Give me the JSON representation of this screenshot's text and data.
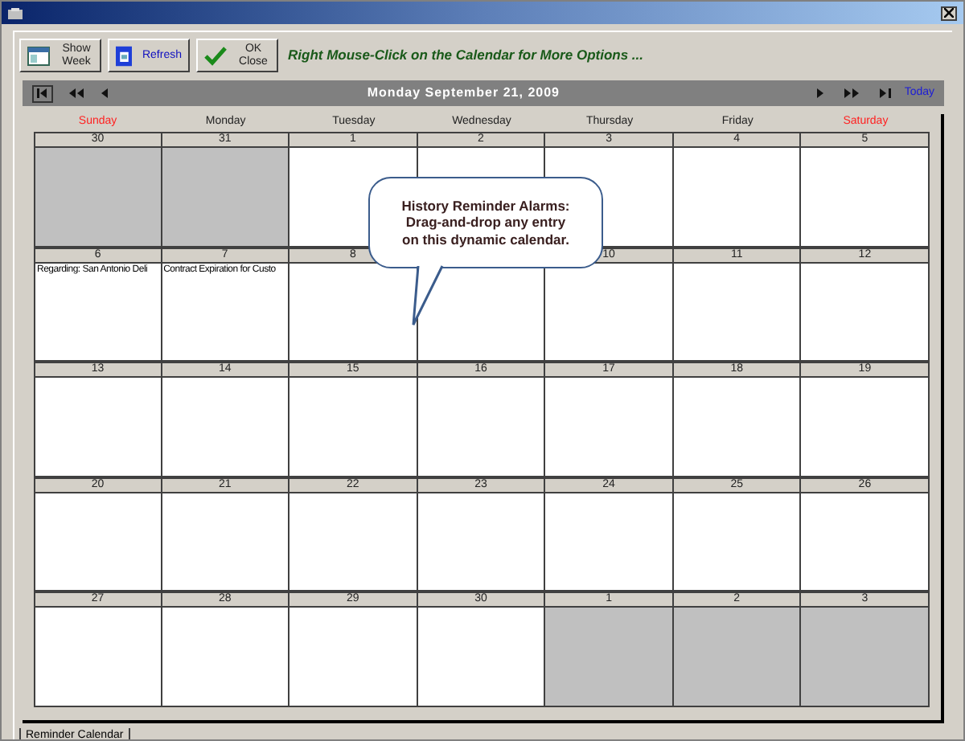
{
  "toolbar": {
    "buttons": [
      {
        "kind": "week",
        "label": "Show\nWeek"
      },
      {
        "kind": "refresh",
        "label": "Refresh"
      },
      {
        "kind": "close",
        "label": "OK\nClose"
      }
    ],
    "hint": "Right Mouse-Click on the Calendar for More Options ..."
  },
  "nav": {
    "date": "Monday September 21, 2009",
    "today": "Today"
  },
  "weekdays": [
    {
      "label": "Sunday",
      "weekend": true
    },
    {
      "label": "Monday",
      "weekend": false
    },
    {
      "label": "Tuesday",
      "weekend": false
    },
    {
      "label": "Wednesday",
      "weekend": false
    },
    {
      "label": "Thursday",
      "weekend": false
    },
    {
      "label": "Friday",
      "weekend": false
    },
    {
      "label": "Saturday",
      "weekend": true
    }
  ],
  "weeks": [
    [
      {
        "number": "30",
        "in_month": false
      },
      {
        "number": "31",
        "in_month": false
      },
      {
        "number": "1",
        "in_month": true
      },
      {
        "number": "2",
        "in_month": true
      },
      {
        "number": "3",
        "in_month": true
      },
      {
        "number": "4",
        "in_month": true
      },
      {
        "number": "5",
        "in_month": true
      }
    ],
    [
      {
        "number": "6",
        "in_month": true,
        "entries": [
          "Regarding: San Antonio Deli"
        ]
      },
      {
        "number": "7",
        "in_month": true,
        "entries": [
          "Contract Expiration for Custo"
        ]
      },
      {
        "number": "8",
        "in_month": true
      },
      {
        "in_month": true
      },
      {
        "number": "10",
        "in_month": true
      },
      {
        "number": "11",
        "in_month": true
      },
      {
        "number": "12",
        "in_month": true
      }
    ],
    [
      {
        "number": "13",
        "in_month": true
      },
      {
        "number": "14",
        "in_month": true
      },
      {
        "number": "15",
        "in_month": true
      },
      {
        "number": "16",
        "in_month": true
      },
      {
        "number": "17",
        "in_month": true
      },
      {
        "number": "18",
        "in_month": true
      },
      {
        "number": "19",
        "in_month": true
      }
    ],
    [
      {
        "number": "20",
        "in_month": true
      },
      {
        "number": "21",
        "in_month": true
      },
      {
        "number": "22",
        "in_month": true
      },
      {
        "number": "23",
        "in_month": true
      },
      {
        "number": "24",
        "in_month": true
      },
      {
        "number": "25",
        "in_month": true
      },
      {
        "number": "26",
        "in_month": true
      }
    ],
    [
      {
        "number": "27",
        "in_month": true
      },
      {
        "number": "28",
        "in_month": true
      },
      {
        "number": "29",
        "in_month": true
      },
      {
        "number": "30",
        "in_month": true
      },
      {
        "number": "1",
        "in_month": false
      },
      {
        "number": "2",
        "in_month": false
      },
      {
        "number": "3",
        "in_month": false
      }
    ]
  ],
  "callout": {
    "lines": [
      "History Reminder Alarms:",
      "Drag-and-drop any entry",
      "on this dynamic calendar."
    ]
  },
  "tabs": [
    {
      "label": "Reminder Calendar",
      "selected": true
    }
  ]
}
